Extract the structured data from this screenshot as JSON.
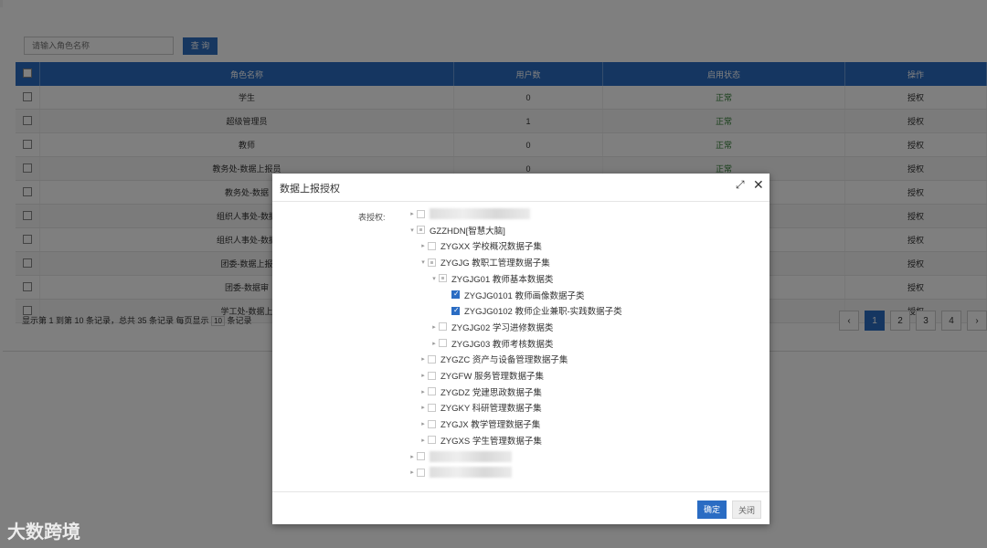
{
  "search": {
    "placeholder": "请输入角色名称",
    "button": "查 询"
  },
  "table": {
    "headers": [
      "角色名称",
      "用户数",
      "启用状态",
      "操作"
    ],
    "rows": [
      {
        "name": "学生",
        "users": "0",
        "status": "正常",
        "action": "授权"
      },
      {
        "name": "超级管理员",
        "users": "1",
        "status": "正常",
        "action": "授权"
      },
      {
        "name": "教师",
        "users": "0",
        "status": "正常",
        "action": "授权"
      },
      {
        "name": "教务处-数据上报员",
        "users": "0",
        "status": "正常",
        "action": "授权"
      },
      {
        "name": "教务处-数据",
        "users": "",
        "status": "",
        "action": "授权"
      },
      {
        "name": "组织人事处-数据",
        "users": "",
        "status": "",
        "action": "授权"
      },
      {
        "name": "组织人事处-数据",
        "users": "",
        "status": "",
        "action": "授权"
      },
      {
        "name": "团委-数据上报",
        "users": "",
        "status": "",
        "action": "授权"
      },
      {
        "name": "团委-数据审",
        "users": "",
        "status": "",
        "action": "授权"
      },
      {
        "name": "学工处-数据上",
        "users": "",
        "status": "",
        "action": "授权"
      }
    ]
  },
  "footer": {
    "text1": "显示第 1 到第 10 条记录，总共 35 条记录 每页显示",
    "page_size": "10",
    "text2": "条记录"
  },
  "pager": {
    "prev": "‹",
    "pages": [
      "1",
      "2",
      "3",
      "4"
    ],
    "next": "›"
  },
  "modal": {
    "title": "数据上报授权",
    "label": "表授权:",
    "tree": [
      {
        "text": "",
        "level": 0,
        "arrow": "▸",
        "state": "none",
        "blur": true
      },
      {
        "text": "GZZHDN[智慧大脑]",
        "level": 0,
        "arrow": "▾",
        "state": "partial"
      },
      {
        "text": "ZYGXX 学校概况数据子集",
        "level": 1,
        "arrow": "▸",
        "state": "none"
      },
      {
        "text": "ZYGJG 教职工管理数据子集",
        "level": 1,
        "arrow": "▾",
        "state": "partial"
      },
      {
        "text": "ZYGJG01 教师基本数据类",
        "level": 2,
        "arrow": "▾",
        "state": "partial"
      },
      {
        "text": "ZYGJG0101 教师画像数据子类",
        "level": 3,
        "arrow": "",
        "state": "checked"
      },
      {
        "text": "ZYGJG0102 教师企业兼职-实践数据子类",
        "level": 3,
        "arrow": "",
        "state": "checked"
      },
      {
        "text": "ZYGJG02 学习进修数据类",
        "level": 2,
        "arrow": "▸",
        "state": "none"
      },
      {
        "text": "ZYGJG03 教师考核数据类",
        "level": 2,
        "arrow": "▸",
        "state": "none"
      },
      {
        "text": "ZYGZC 资产与设备管理数据子集",
        "level": 1,
        "arrow": "▸",
        "state": "none"
      },
      {
        "text": "ZYGFW 服务管理数据子集",
        "level": 1,
        "arrow": "▸",
        "state": "none"
      },
      {
        "text": "ZYGDZ 党建思政数据子集",
        "level": 1,
        "arrow": "▸",
        "state": "none"
      },
      {
        "text": "ZYGKY 科研管理数据子集",
        "level": 1,
        "arrow": "▸",
        "state": "none"
      },
      {
        "text": "ZYGJX 教学管理数据子集",
        "level": 1,
        "arrow": "▸",
        "state": "none"
      },
      {
        "text": "ZYGXS 学生管理数据子集",
        "level": 1,
        "arrow": "▸",
        "state": "none"
      },
      {
        "text": "",
        "level": 0,
        "arrow": "▸",
        "state": "none",
        "blur": true
      },
      {
        "text": "",
        "level": 0,
        "arrow": "▸",
        "state": "none",
        "blur": true
      }
    ],
    "ok": "确定",
    "close": "关闭"
  },
  "watermark": "大数跨境"
}
